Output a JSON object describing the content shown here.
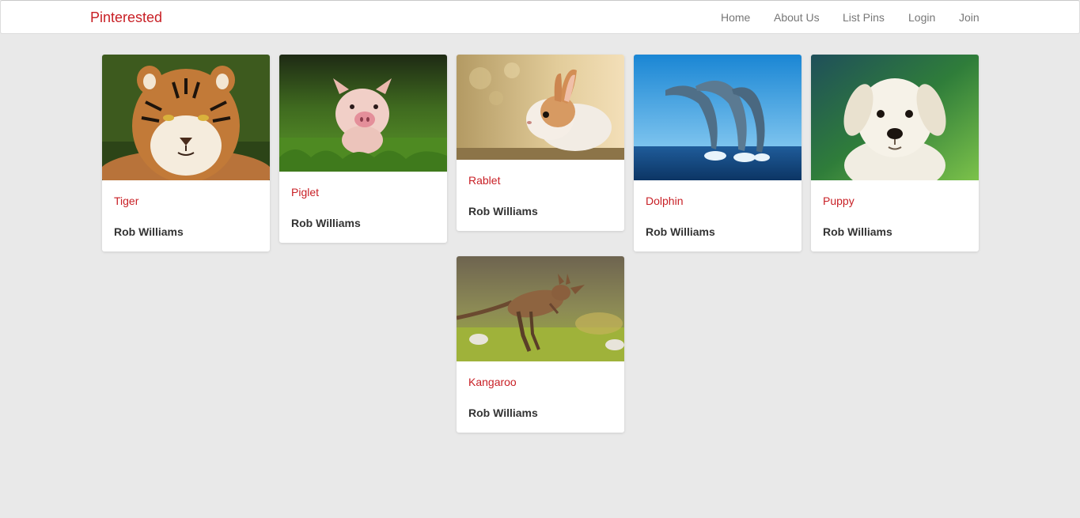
{
  "brand": {
    "label": "Pinterested",
    "color": "#c81f25"
  },
  "nav": {
    "items": [
      {
        "label": "Home",
        "icon": "none"
      },
      {
        "label": "About Us",
        "icon": "none"
      },
      {
        "label": "List Pins",
        "icon": "none"
      },
      {
        "label": "Login",
        "icon": "none"
      },
      {
        "label": "Join",
        "icon": "none"
      }
    ]
  },
  "pins": [
    {
      "title": "Tiger",
      "author": "Rob Williams",
      "image": "tiger-photo"
    },
    {
      "title": "Piglet",
      "author": "Rob Williams",
      "image": "piglet-photo"
    },
    {
      "title": "Rablet",
      "author": "Rob Williams",
      "image": "rabbit-photo"
    },
    {
      "title": "Dolphin",
      "author": "Rob Williams",
      "image": "dolphin-photo"
    },
    {
      "title": "Puppy",
      "author": "Rob Williams",
      "image": "puppy-photo"
    },
    {
      "title": "Kangaroo",
      "author": "Rob Williams",
      "image": "kangaroo-photo"
    }
  ],
  "colors": {
    "page_background": "#e9e9e9",
    "accent": "#c81f25",
    "nav_text": "#777777",
    "author_text": "#333333"
  }
}
